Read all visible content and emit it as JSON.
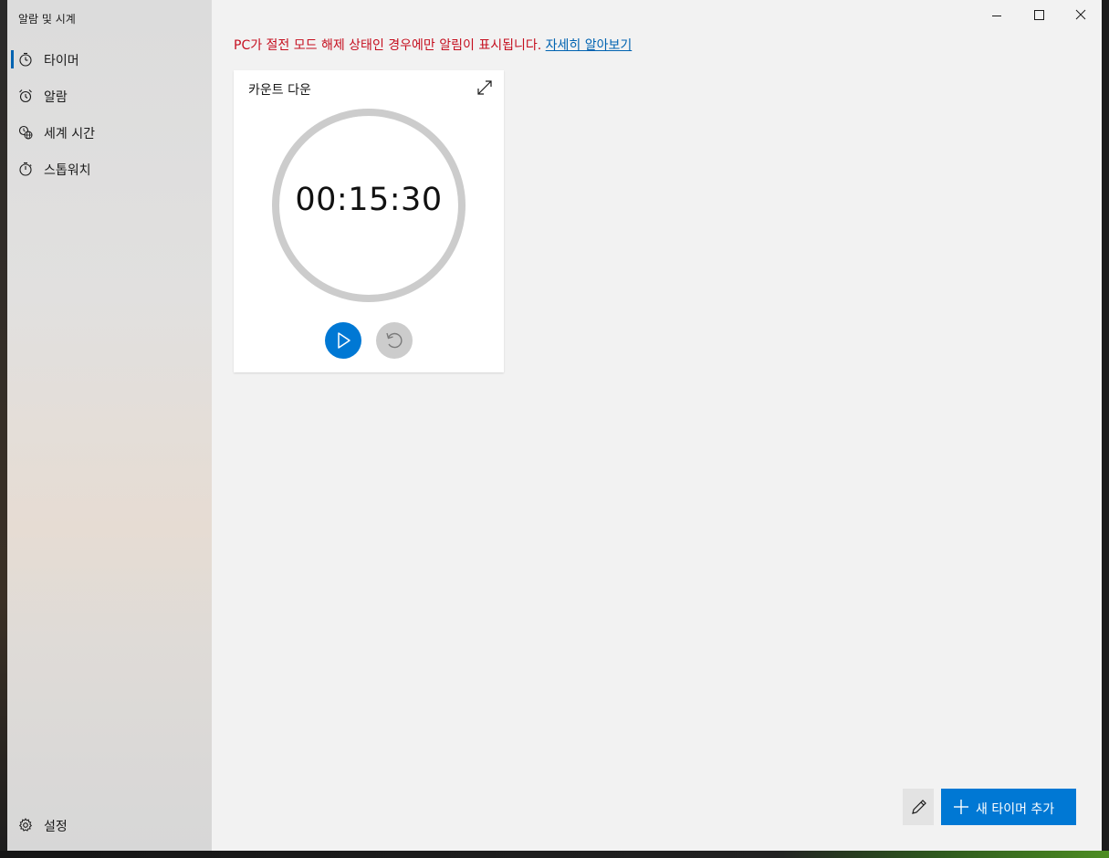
{
  "app": {
    "title": "알람 및 시계"
  },
  "sidebar": {
    "items": [
      {
        "label": "타이머",
        "icon": "timer-icon",
        "active": true
      },
      {
        "label": "알람",
        "icon": "alarm-clock-icon",
        "active": false
      },
      {
        "label": "세계 시간",
        "icon": "world-clock-icon",
        "active": false
      },
      {
        "label": "스톱워치",
        "icon": "stopwatch-icon",
        "active": false
      }
    ],
    "settings_label": "설정"
  },
  "banner": {
    "message": "PC가 절전 모드 해제 상태인 경우에만 알림이 표시됩니다.",
    "link_text": "자세히 알아보기"
  },
  "timers": [
    {
      "name": "카운트 다운",
      "time": "00:15:30"
    }
  ],
  "footer": {
    "add_label": "새 타이머 추가"
  },
  "colors": {
    "accent": "#0078d4",
    "warning": "#c50f1f",
    "link": "#0063b1"
  }
}
